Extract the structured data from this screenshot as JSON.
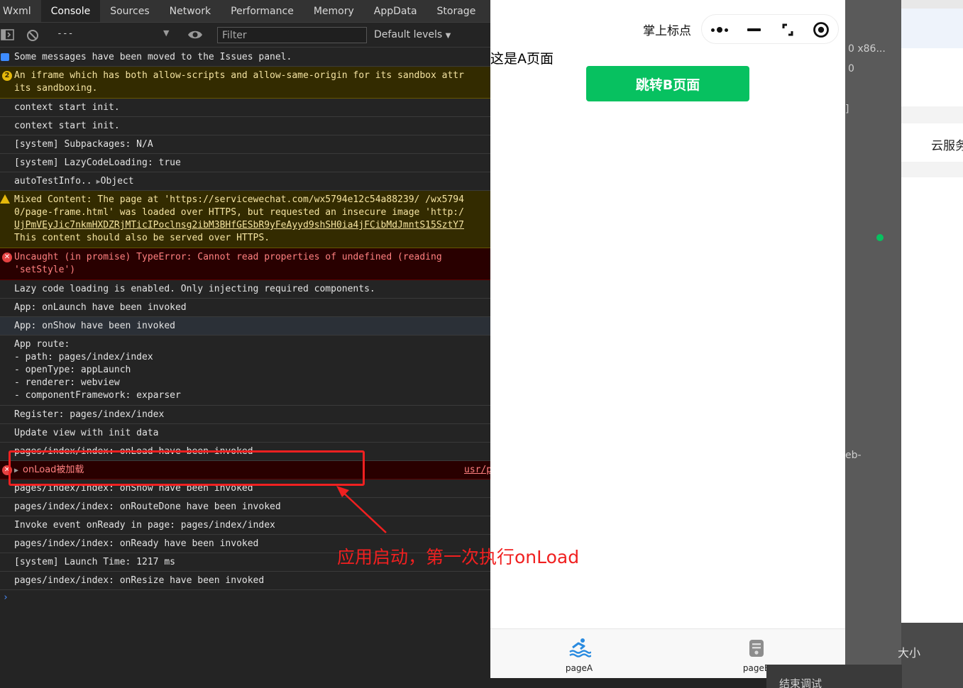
{
  "devtools": {
    "tabs": [
      "Wxml",
      "Console",
      "Sources",
      "Network",
      "Performance",
      "Memory",
      "AppData",
      "Storage"
    ],
    "active_tab": "Console",
    "toolbar": {
      "context_value": "---",
      "filter_placeholder": "Filter",
      "levels_label": "Default levels"
    },
    "log": [
      {
        "kind": "info",
        "text": "Some messages have been moved to the Issues panel."
      },
      {
        "kind": "warn",
        "count": "2",
        "lines": [
          "An iframe which has both allow-scripts and allow-same-origin for its sandbox attr",
          "its sandboxing."
        ]
      },
      {
        "kind": "plain",
        "text": "context start init."
      },
      {
        "kind": "plain",
        "text": "context start init."
      },
      {
        "kind": "plain",
        "text": "[system] Subpackages: N/A"
      },
      {
        "kind": "plain",
        "text": "[system] LazyCodeLoading: true"
      },
      {
        "kind": "plain",
        "text": "autoTestInfo..",
        "object": "Object"
      },
      {
        "kind": "warn-mixed",
        "lines": [
          "Mixed Content: The page at 'https://servicewechat.com/wx5794e12c54a88239/ /wx5794",
          "0/page-frame.html' was loaded over HTTPS, but requested an insecure image 'http:/",
          "UjPmVEyJic7nkmHXDZRjMTicIPoclnsg2ibM3BHfGESbR9yFeAyyd9shSH0ia4jFCibMdJmntS15SztY7",
          "This content should also be served over HTTPS."
        ]
      },
      {
        "kind": "error",
        "lines": [
          "Uncaught (in promise) TypeError: Cannot read properties of undefined (reading",
          "'setStyle')"
        ]
      },
      {
        "kind": "plain",
        "text": "Lazy code loading is enabled. Only injecting required components."
      },
      {
        "kind": "plain",
        "text": "App: onLaunch have been invoked"
      },
      {
        "kind": "highlight",
        "text": "App: onShow have been invoked"
      },
      {
        "kind": "plain-multi",
        "lines": [
          "App route:",
          "- path: pages/index/index",
          "- openType: appLaunch",
          "- renderer: webview",
          "- componentFramework: exparser"
        ]
      },
      {
        "kind": "plain",
        "text": "Register: pages/index/index"
      },
      {
        "kind": "plain",
        "text": "Update view with init data"
      },
      {
        "kind": "plain",
        "text": "pages/index/index: onLoad have been invoked"
      },
      {
        "kind": "error-small",
        "text": "onLoad被加载",
        "source": "usr/p"
      },
      {
        "kind": "plain",
        "text": "pages/index/index: onShow have been invoked"
      },
      {
        "kind": "plain",
        "text": "pages/index/index: onRouteDone have been invoked"
      },
      {
        "kind": "plain",
        "text": "Invoke event onReady in page: pages/index/index"
      },
      {
        "kind": "plain",
        "text": "pages/index/index: onReady have been invoked"
      },
      {
        "kind": "plain",
        "text": "[system] Launch Time: 1217 ms"
      },
      {
        "kind": "plain",
        "text": "pages/index/index: onResize have been invoked"
      }
    ],
    "prompt": "›"
  },
  "simulator": {
    "nav_title": "掌上标点",
    "page_text": "这是A页面",
    "button_label": "跳转B页面",
    "tabbar": [
      {
        "label": "pageA",
        "icon": "swimmer-icon"
      },
      {
        "label": "pageB",
        "icon": "document-icon"
      }
    ]
  },
  "right_panel": {
    "texts": [
      "0 x86...",
      "0",
      "]",
      "云服务",
      "eb-",
      "大小",
      "结束调试"
    ]
  },
  "annotation": {
    "text": "应用启动，第一次执行onLoad",
    "color": "#f02020"
  }
}
